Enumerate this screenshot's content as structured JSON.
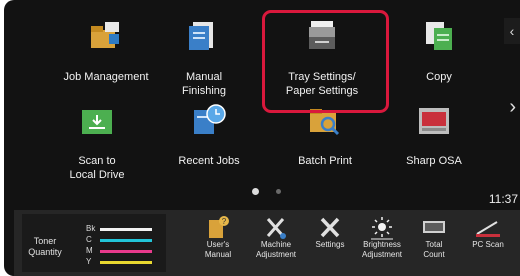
{
  "home": {
    "tiles": [
      {
        "label_lines": [
          "Job Management"
        ],
        "icon": "job-management-icon"
      },
      {
        "label_lines": [
          "Manual",
          "Finishing"
        ],
        "icon": "manual-finishing-icon"
      },
      {
        "label_lines": [
          "Tray Settings/",
          "Paper Settings"
        ],
        "icon": "tray-settings-icon"
      },
      {
        "label_lines": [
          "Copy"
        ],
        "icon": "copy-icon"
      },
      {
        "label_lines": [
          "Scan to",
          "Local Drive"
        ],
        "icon": "scan-to-local-drive-icon"
      },
      {
        "label_lines": [
          "Recent Jobs"
        ],
        "icon": "recent-jobs-icon"
      },
      {
        "label_lines": [
          "Batch Print"
        ],
        "icon": "batch-print-icon"
      },
      {
        "label_lines": [
          "Sharp OSA"
        ],
        "icon": "sharp-osa-icon"
      }
    ],
    "highlighted_tile": "Tray Settings/ Paper Settings",
    "page_indicator": {
      "pages": 2,
      "current": 1
    },
    "clock": "11:37"
  },
  "toner": {
    "label_lines": [
      "Toner",
      "Quantity"
    ],
    "rows": [
      {
        "key": "Bk",
        "color": "#f2f2f2"
      },
      {
        "key": "C",
        "color": "#22c4d8"
      },
      {
        "key": "M",
        "color": "#e83a8c"
      },
      {
        "key": "Y",
        "color": "#e8d830"
      }
    ]
  },
  "bottom_bar": [
    {
      "label_lines": [
        "User's",
        "Manual"
      ],
      "icon": "users-manual-icon"
    },
    {
      "label_lines": [
        "Machine",
        "Adjustment"
      ],
      "icon": "machine-adjustment-icon"
    },
    {
      "label_lines": [
        "Settings"
      ],
      "icon": "settings-icon"
    },
    {
      "label_lines": [
        "Brightness",
        "Adjustment"
      ],
      "icon": "brightness-icon"
    },
    {
      "label_lines": [
        "Total",
        "Count"
      ],
      "icon": "total-count-icon"
    },
    {
      "label_lines": [
        "PC Scan"
      ],
      "icon": "pc-scan-icon"
    }
  ],
  "colors": {
    "highlight": "#d9183c",
    "screen_bg": "#121212",
    "bar_bg": "#262626"
  }
}
